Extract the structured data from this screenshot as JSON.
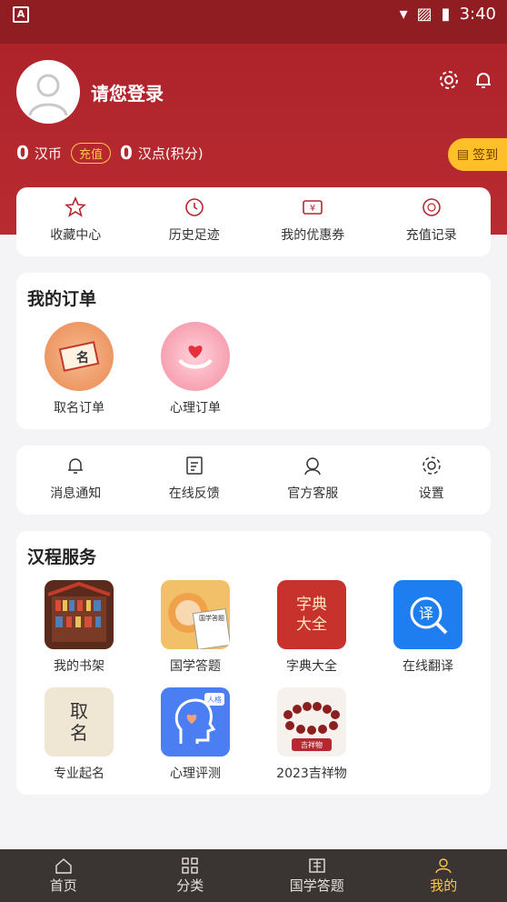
{
  "status": {
    "time": "3:40"
  },
  "profile": {
    "login_text": "请您登录"
  },
  "balance": {
    "coins": "0",
    "coin_label": "汉币",
    "topup": "充值",
    "points": "0",
    "points_label": "汉点(积分)",
    "sign_label": "签到"
  },
  "quick": [
    {
      "label": "收藏中心",
      "icon": "star-icon"
    },
    {
      "label": "历史足迹",
      "icon": "clock-icon"
    },
    {
      "label": "我的优惠券",
      "icon": "coupon-icon"
    },
    {
      "label": "充值记录",
      "icon": "coin-record-icon"
    }
  ],
  "orders": {
    "title": "我的订单",
    "items": [
      {
        "label": "取名订单",
        "icon": "name-scroll-icon"
      },
      {
        "label": "心理订单",
        "icon": "heart-hands-icon"
      }
    ]
  },
  "tools": [
    {
      "label": "消息通知",
      "icon": "bell-icon"
    },
    {
      "label": "在线反馈",
      "icon": "feedback-icon"
    },
    {
      "label": "官方客服",
      "icon": "headset-icon"
    },
    {
      "label": "设置",
      "icon": "gear-icon"
    }
  ],
  "services": {
    "title": "汉程服务",
    "items": [
      {
        "label": "我的书架",
        "icon": "bookshelf-icon"
      },
      {
        "label": "国学答题",
        "icon": "quiz-icon",
        "badge": "国学答题"
      },
      {
        "label": "字典大全",
        "icon": "dictionary-icon",
        "line1": "字典",
        "line2": "大全"
      },
      {
        "label": "在线翻译",
        "icon": "translate-icon",
        "glyph": "译"
      },
      {
        "label": "专业起名",
        "icon": "naming-icon",
        "line1": "取",
        "line2": "名"
      },
      {
        "label": "心理评测",
        "icon": "psych-test-icon",
        "badge": "人格"
      },
      {
        "label": "2023吉祥物",
        "icon": "mascot-beads-icon",
        "badge": "吉祥物"
      }
    ]
  },
  "tabs": [
    {
      "label": "首页",
      "icon": "home-icon"
    },
    {
      "label": "分类",
      "icon": "grid-icon"
    },
    {
      "label": "国学答题",
      "icon": "quiz-tab-icon"
    },
    {
      "label": "我的",
      "icon": "user-icon",
      "active": true
    }
  ],
  "colors": {
    "hero": "#b52830",
    "accent": "#ffbf28",
    "tabbar": "#3a3432"
  }
}
